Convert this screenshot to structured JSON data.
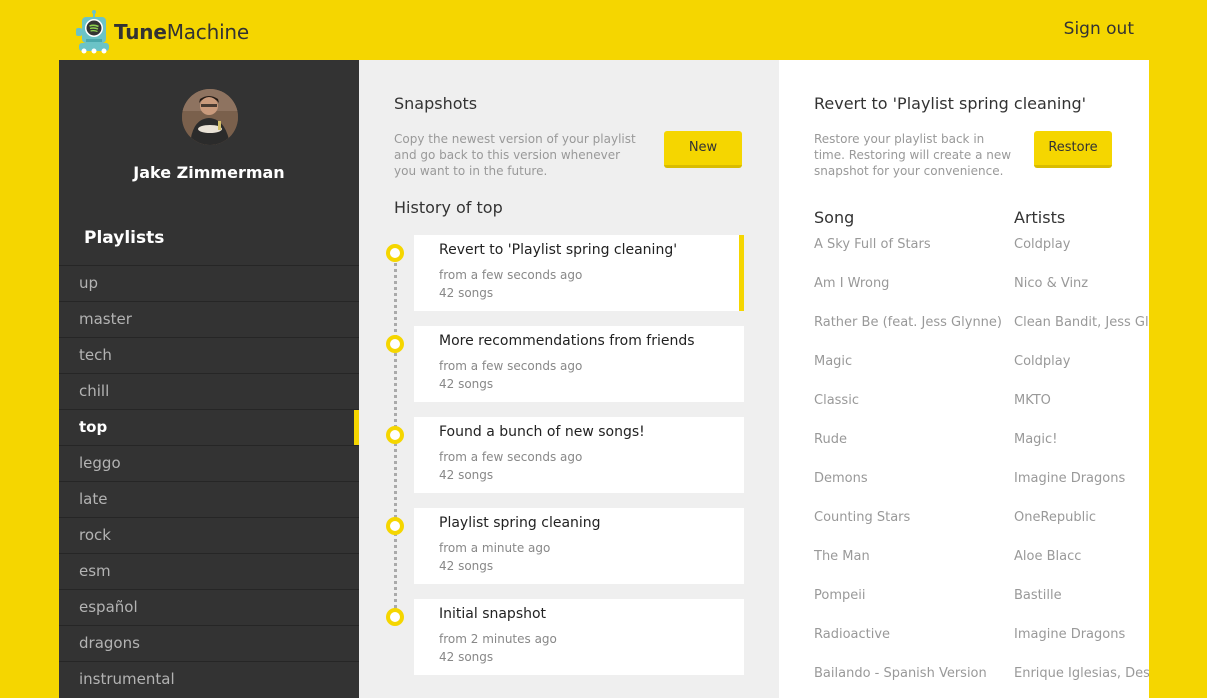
{
  "app": {
    "name_bold": "Tune",
    "name_rest": "Machine",
    "sign_out": "Sign out"
  },
  "colors": {
    "brand": "#f5d600",
    "sidebar_bg": "#333333",
    "middle_bg": "#efefef"
  },
  "user": {
    "name": "Jake Zimmerman"
  },
  "sidebar": {
    "heading": "Playlists",
    "items": [
      {
        "label": "up"
      },
      {
        "label": "master"
      },
      {
        "label": "tech"
      },
      {
        "label": "chill"
      },
      {
        "label": "top",
        "active": true
      },
      {
        "label": "leggo"
      },
      {
        "label": "late"
      },
      {
        "label": "rock"
      },
      {
        "label": "esm"
      },
      {
        "label": "español"
      },
      {
        "label": "dragons"
      },
      {
        "label": "instrumental"
      }
    ]
  },
  "snapshots": {
    "heading": "Snapshots",
    "description": "Copy the newest version of your playlist and go back to this version whenever you want to in the future.",
    "new_button": "New"
  },
  "history": {
    "heading": "History of top",
    "items": [
      {
        "title": "Revert to 'Playlist spring cleaning'",
        "time": "from a few seconds ago",
        "count": "42 songs",
        "active": true
      },
      {
        "title": "More recommendations from friends",
        "time": "from a few seconds ago",
        "count": "42 songs"
      },
      {
        "title": "Found a bunch of new songs!",
        "time": "from a few seconds ago",
        "count": "42 songs"
      },
      {
        "title": "Playlist spring cleaning",
        "time": "from a minute ago",
        "count": "42 songs"
      },
      {
        "title": "Initial snapshot",
        "time": "from 2 minutes ago",
        "count": "42 songs"
      }
    ]
  },
  "revert": {
    "heading": "Revert to 'Playlist spring cleaning'",
    "description": "Restore your playlist back in time. Restoring will create a new snapshot for your convenience.",
    "restore_button": "Restore",
    "song_header": "Song",
    "artist_header": "Artists",
    "tracks": [
      {
        "song": "A Sky Full of Stars",
        "artist": "Coldplay"
      },
      {
        "song": "Am I Wrong",
        "artist": "Nico & Vinz"
      },
      {
        "song": "Rather Be (feat. Jess Glynne)",
        "artist": "Clean Bandit, Jess Glynne"
      },
      {
        "song": "Magic",
        "artist": "Coldplay"
      },
      {
        "song": "Classic",
        "artist": "MKTO"
      },
      {
        "song": "Rude",
        "artist": "Magic!"
      },
      {
        "song": "Demons",
        "artist": "Imagine Dragons"
      },
      {
        "song": "Counting Stars",
        "artist": "OneRepublic"
      },
      {
        "song": "The Man",
        "artist": "Aloe Blacc"
      },
      {
        "song": "Pompeii",
        "artist": "Bastille"
      },
      {
        "song": "Radioactive",
        "artist": "Imagine Dragons"
      },
      {
        "song": "Bailando - Spanish Version",
        "artist": "Enrique Iglesias, Descemer Bueno"
      }
    ]
  }
}
